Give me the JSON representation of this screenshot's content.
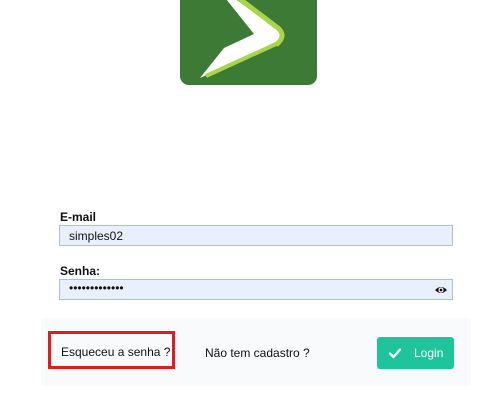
{
  "form": {
    "email_label": "E-mail",
    "email_value": "simples02",
    "password_label": "Senha:",
    "password_mask": "•••••••••••••"
  },
  "footer": {
    "forgot_label": "Esqueceu a senha ?",
    "signup_label": "Não tem cadastro ?",
    "login_label": "Login"
  },
  "icons": {
    "logo": "app-logo",
    "eye": "eye-icon",
    "check": "check-icon"
  },
  "colors": {
    "logo_bg": "#3d7a35",
    "login_button": "#1ec49b",
    "highlight_border": "#e21b1b",
    "input_bg": "#e8f0fe"
  }
}
